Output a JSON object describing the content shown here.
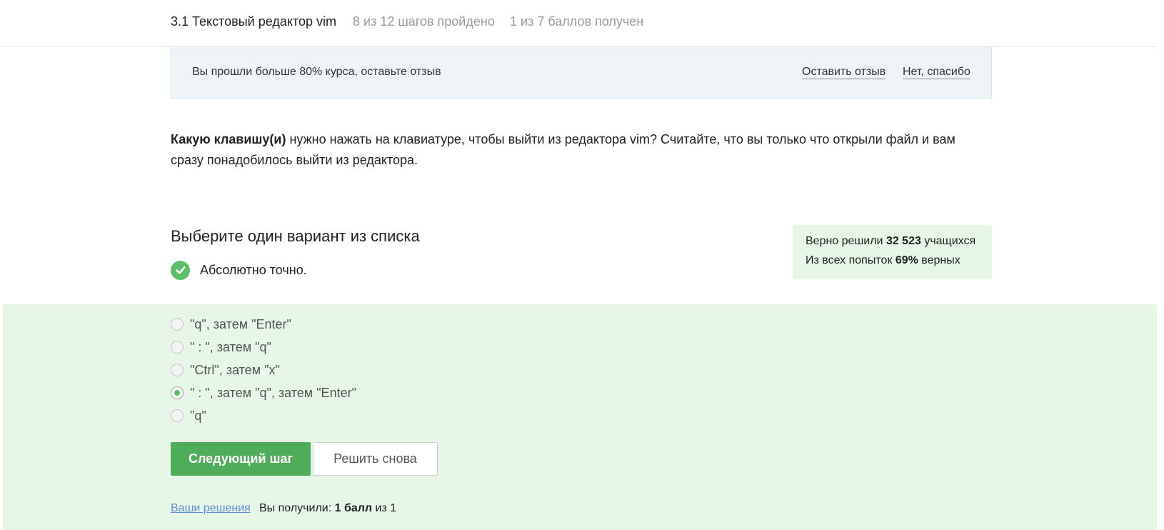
{
  "header": {
    "lesson_title": "3.1 Текстовый редактор vim",
    "steps_progress": "8 из 12 шагов пройдено",
    "points_progress": "1 из 7 баллов  получен"
  },
  "feedback_banner": {
    "text": "Вы прошли больше 80% курса, оставьте отзыв",
    "leave_review_label": "Оставить отзыв",
    "no_thanks_label": "Нет, спасибо"
  },
  "question": {
    "bold_part": "Какую клавишу(и)",
    "rest": " нужно нажать на клавиатуре, чтобы выйти из редактора vim? Считайте, что вы только что открыли файл и вам сразу понадобилось выйти из редактора."
  },
  "quiz": {
    "title": "Выберите один вариант из списка",
    "result_text": "Абсолютно точно.",
    "options": [
      {
        "label": "\"q\", затем \"Enter\"",
        "selected": false
      },
      {
        "label": "\" : \", затем \"q\"",
        "selected": false
      },
      {
        "label": "\"Ctrl\", затем \"x\"",
        "selected": false
      },
      {
        "label": "\" : \", затем \"q\", затем \"Enter\"",
        "selected": true
      },
      {
        "label": "\"q\"",
        "selected": false
      }
    ],
    "next_button": "Следующий шаг",
    "retry_button": "Решить снова"
  },
  "stats": {
    "solved_prefix": "Верно решили ",
    "solved_count": "32 523",
    "solved_suffix": " учащихся",
    "attempts_prefix": "Из всех попыток ",
    "attempts_percent": "69%",
    "attempts_suffix": " верных"
  },
  "footer": {
    "solutions_link": "Ваши решения",
    "score_prefix": "Вы получили: ",
    "score_bold": "1 балл",
    "score_suffix": " из 1"
  },
  "colors": {
    "accent_green": "#4fac59",
    "success_bg": "#e6f7e8",
    "check_green": "#5cbf68",
    "link_blue": "#5b8ed6"
  }
}
